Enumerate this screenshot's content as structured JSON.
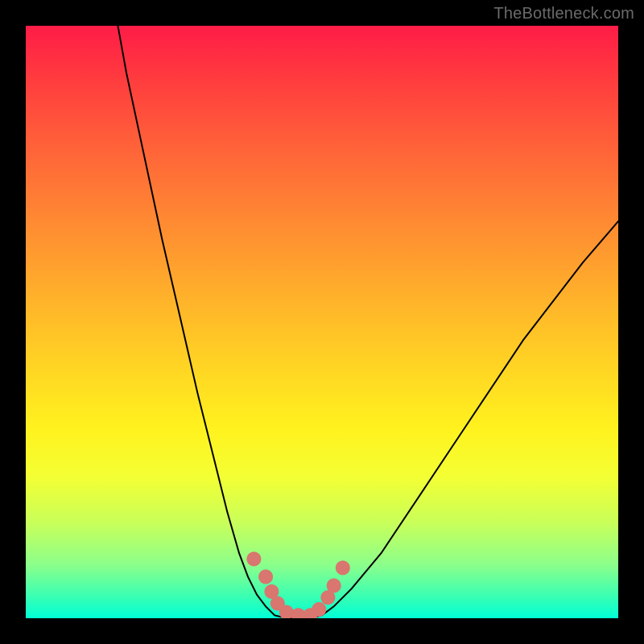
{
  "watermark": "TheBottleneck.com",
  "chart_data": {
    "type": "line",
    "title": "",
    "xlabel": "",
    "ylabel": "",
    "xlim": [
      0,
      100
    ],
    "ylim": [
      0,
      100
    ],
    "series": [
      {
        "name": "curve-left",
        "x": [
          15,
          17,
          20,
          23,
          26,
          29,
          32,
          34,
          36,
          37.5,
          39,
          40.5,
          42
        ],
        "y": [
          103,
          92,
          78,
          64,
          51,
          38,
          26,
          18,
          11,
          7,
          4,
          2,
          0.5
        ]
      },
      {
        "name": "curve-floor",
        "x": [
          42,
          44,
          46,
          48,
          50
        ],
        "y": [
          0.5,
          0,
          0,
          0,
          0.5
        ]
      },
      {
        "name": "curve-right",
        "x": [
          50,
          52,
          55,
          60,
          66,
          74,
          84,
          94,
          100
        ],
        "y": [
          0.5,
          2,
          5,
          11,
          20,
          32,
          47,
          60,
          67
        ]
      }
    ],
    "markers": {
      "name": "highlight-dots",
      "points": [
        {
          "x": 38.5,
          "y": 10
        },
        {
          "x": 40.5,
          "y": 7
        },
        {
          "x": 41.5,
          "y": 4.5
        },
        {
          "x": 42.5,
          "y": 2.5
        },
        {
          "x": 44,
          "y": 1
        },
        {
          "x": 46,
          "y": 0.5
        },
        {
          "x": 48,
          "y": 0.5
        },
        {
          "x": 49.5,
          "y": 1.5
        },
        {
          "x": 51,
          "y": 3.5
        },
        {
          "x": 52,
          "y": 5.5
        },
        {
          "x": 53.5,
          "y": 8.5
        }
      ]
    }
  }
}
